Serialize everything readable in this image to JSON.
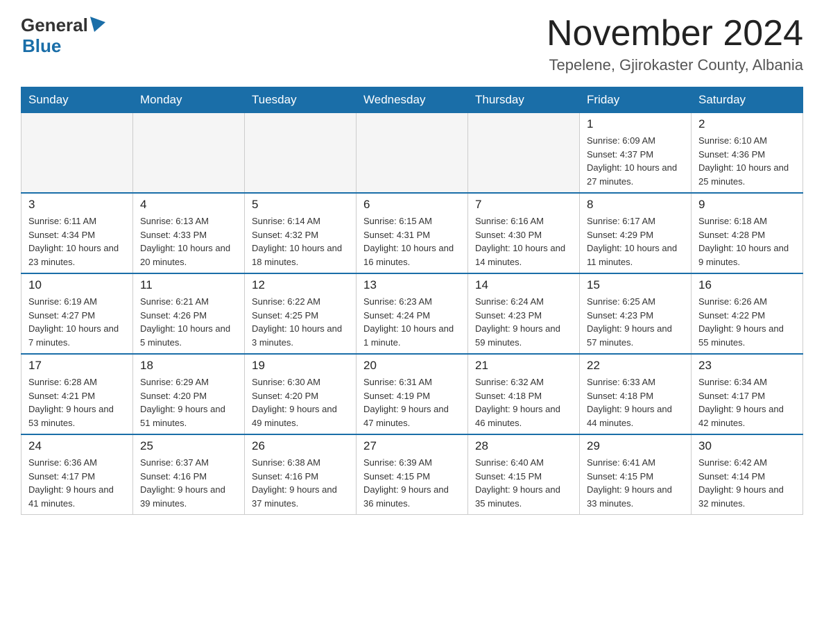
{
  "header": {
    "logo_general": "General",
    "logo_blue": "Blue",
    "month_title": "November 2024",
    "location": "Tepelene, Gjirokaster County, Albania"
  },
  "days_of_week": [
    "Sunday",
    "Monday",
    "Tuesday",
    "Wednesday",
    "Thursday",
    "Friday",
    "Saturday"
  ],
  "weeks": [
    {
      "days": [
        {
          "number": "",
          "sunrise": "",
          "sunset": "",
          "daylight": "",
          "empty": true
        },
        {
          "number": "",
          "sunrise": "",
          "sunset": "",
          "daylight": "",
          "empty": true
        },
        {
          "number": "",
          "sunrise": "",
          "sunset": "",
          "daylight": "",
          "empty": true
        },
        {
          "number": "",
          "sunrise": "",
          "sunset": "",
          "daylight": "",
          "empty": true
        },
        {
          "number": "",
          "sunrise": "",
          "sunset": "",
          "daylight": "",
          "empty": true
        },
        {
          "number": "1",
          "sunrise": "Sunrise: 6:09 AM",
          "sunset": "Sunset: 4:37 PM",
          "daylight": "Daylight: 10 hours and 27 minutes.",
          "empty": false
        },
        {
          "number": "2",
          "sunrise": "Sunrise: 6:10 AM",
          "sunset": "Sunset: 4:36 PM",
          "daylight": "Daylight: 10 hours and 25 minutes.",
          "empty": false
        }
      ]
    },
    {
      "days": [
        {
          "number": "3",
          "sunrise": "Sunrise: 6:11 AM",
          "sunset": "Sunset: 4:34 PM",
          "daylight": "Daylight: 10 hours and 23 minutes.",
          "empty": false
        },
        {
          "number": "4",
          "sunrise": "Sunrise: 6:13 AM",
          "sunset": "Sunset: 4:33 PM",
          "daylight": "Daylight: 10 hours and 20 minutes.",
          "empty": false
        },
        {
          "number": "5",
          "sunrise": "Sunrise: 6:14 AM",
          "sunset": "Sunset: 4:32 PM",
          "daylight": "Daylight: 10 hours and 18 minutes.",
          "empty": false
        },
        {
          "number": "6",
          "sunrise": "Sunrise: 6:15 AM",
          "sunset": "Sunset: 4:31 PM",
          "daylight": "Daylight: 10 hours and 16 minutes.",
          "empty": false
        },
        {
          "number": "7",
          "sunrise": "Sunrise: 6:16 AM",
          "sunset": "Sunset: 4:30 PM",
          "daylight": "Daylight: 10 hours and 14 minutes.",
          "empty": false
        },
        {
          "number": "8",
          "sunrise": "Sunrise: 6:17 AM",
          "sunset": "Sunset: 4:29 PM",
          "daylight": "Daylight: 10 hours and 11 minutes.",
          "empty": false
        },
        {
          "number": "9",
          "sunrise": "Sunrise: 6:18 AM",
          "sunset": "Sunset: 4:28 PM",
          "daylight": "Daylight: 10 hours and 9 minutes.",
          "empty": false
        }
      ]
    },
    {
      "days": [
        {
          "number": "10",
          "sunrise": "Sunrise: 6:19 AM",
          "sunset": "Sunset: 4:27 PM",
          "daylight": "Daylight: 10 hours and 7 minutes.",
          "empty": false
        },
        {
          "number": "11",
          "sunrise": "Sunrise: 6:21 AM",
          "sunset": "Sunset: 4:26 PM",
          "daylight": "Daylight: 10 hours and 5 minutes.",
          "empty": false
        },
        {
          "number": "12",
          "sunrise": "Sunrise: 6:22 AM",
          "sunset": "Sunset: 4:25 PM",
          "daylight": "Daylight: 10 hours and 3 minutes.",
          "empty": false
        },
        {
          "number": "13",
          "sunrise": "Sunrise: 6:23 AM",
          "sunset": "Sunset: 4:24 PM",
          "daylight": "Daylight: 10 hours and 1 minute.",
          "empty": false
        },
        {
          "number": "14",
          "sunrise": "Sunrise: 6:24 AM",
          "sunset": "Sunset: 4:23 PM",
          "daylight": "Daylight: 9 hours and 59 minutes.",
          "empty": false
        },
        {
          "number": "15",
          "sunrise": "Sunrise: 6:25 AM",
          "sunset": "Sunset: 4:23 PM",
          "daylight": "Daylight: 9 hours and 57 minutes.",
          "empty": false
        },
        {
          "number": "16",
          "sunrise": "Sunrise: 6:26 AM",
          "sunset": "Sunset: 4:22 PM",
          "daylight": "Daylight: 9 hours and 55 minutes.",
          "empty": false
        }
      ]
    },
    {
      "days": [
        {
          "number": "17",
          "sunrise": "Sunrise: 6:28 AM",
          "sunset": "Sunset: 4:21 PM",
          "daylight": "Daylight: 9 hours and 53 minutes.",
          "empty": false
        },
        {
          "number": "18",
          "sunrise": "Sunrise: 6:29 AM",
          "sunset": "Sunset: 4:20 PM",
          "daylight": "Daylight: 9 hours and 51 minutes.",
          "empty": false
        },
        {
          "number": "19",
          "sunrise": "Sunrise: 6:30 AM",
          "sunset": "Sunset: 4:20 PM",
          "daylight": "Daylight: 9 hours and 49 minutes.",
          "empty": false
        },
        {
          "number": "20",
          "sunrise": "Sunrise: 6:31 AM",
          "sunset": "Sunset: 4:19 PM",
          "daylight": "Daylight: 9 hours and 47 minutes.",
          "empty": false
        },
        {
          "number": "21",
          "sunrise": "Sunrise: 6:32 AM",
          "sunset": "Sunset: 4:18 PM",
          "daylight": "Daylight: 9 hours and 46 minutes.",
          "empty": false
        },
        {
          "number": "22",
          "sunrise": "Sunrise: 6:33 AM",
          "sunset": "Sunset: 4:18 PM",
          "daylight": "Daylight: 9 hours and 44 minutes.",
          "empty": false
        },
        {
          "number": "23",
          "sunrise": "Sunrise: 6:34 AM",
          "sunset": "Sunset: 4:17 PM",
          "daylight": "Daylight: 9 hours and 42 minutes.",
          "empty": false
        }
      ]
    },
    {
      "days": [
        {
          "number": "24",
          "sunrise": "Sunrise: 6:36 AM",
          "sunset": "Sunset: 4:17 PM",
          "daylight": "Daylight: 9 hours and 41 minutes.",
          "empty": false
        },
        {
          "number": "25",
          "sunrise": "Sunrise: 6:37 AM",
          "sunset": "Sunset: 4:16 PM",
          "daylight": "Daylight: 9 hours and 39 minutes.",
          "empty": false
        },
        {
          "number": "26",
          "sunrise": "Sunrise: 6:38 AM",
          "sunset": "Sunset: 4:16 PM",
          "daylight": "Daylight: 9 hours and 37 minutes.",
          "empty": false
        },
        {
          "number": "27",
          "sunrise": "Sunrise: 6:39 AM",
          "sunset": "Sunset: 4:15 PM",
          "daylight": "Daylight: 9 hours and 36 minutes.",
          "empty": false
        },
        {
          "number": "28",
          "sunrise": "Sunrise: 6:40 AM",
          "sunset": "Sunset: 4:15 PM",
          "daylight": "Daylight: 9 hours and 35 minutes.",
          "empty": false
        },
        {
          "number": "29",
          "sunrise": "Sunrise: 6:41 AM",
          "sunset": "Sunset: 4:15 PM",
          "daylight": "Daylight: 9 hours and 33 minutes.",
          "empty": false
        },
        {
          "number": "30",
          "sunrise": "Sunrise: 6:42 AM",
          "sunset": "Sunset: 4:14 PM",
          "daylight": "Daylight: 9 hours and 32 minutes.",
          "empty": false
        }
      ]
    }
  ]
}
